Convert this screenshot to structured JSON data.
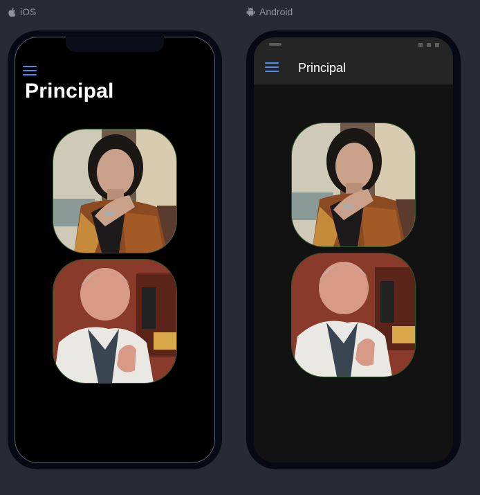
{
  "platforms": {
    "ios": {
      "label": "iOS",
      "icon": "apple-icon"
    },
    "android": {
      "label": "Android",
      "icon": "android-icon"
    }
  },
  "page": {
    "title": "Principal",
    "menu_icon": "hamburger-menu-icon",
    "photos": [
      {
        "name": "woman-portrait-photo"
      },
      {
        "name": "man-portrait-photo"
      }
    ]
  },
  "colors": {
    "accent": "#4d8ef5",
    "background": "#262b36",
    "device_frame": "#070a14",
    "ios_screen": "#000000",
    "android_screen": "#121212",
    "android_appbar": "#252525",
    "photo_border": "#2c5a2c"
  }
}
